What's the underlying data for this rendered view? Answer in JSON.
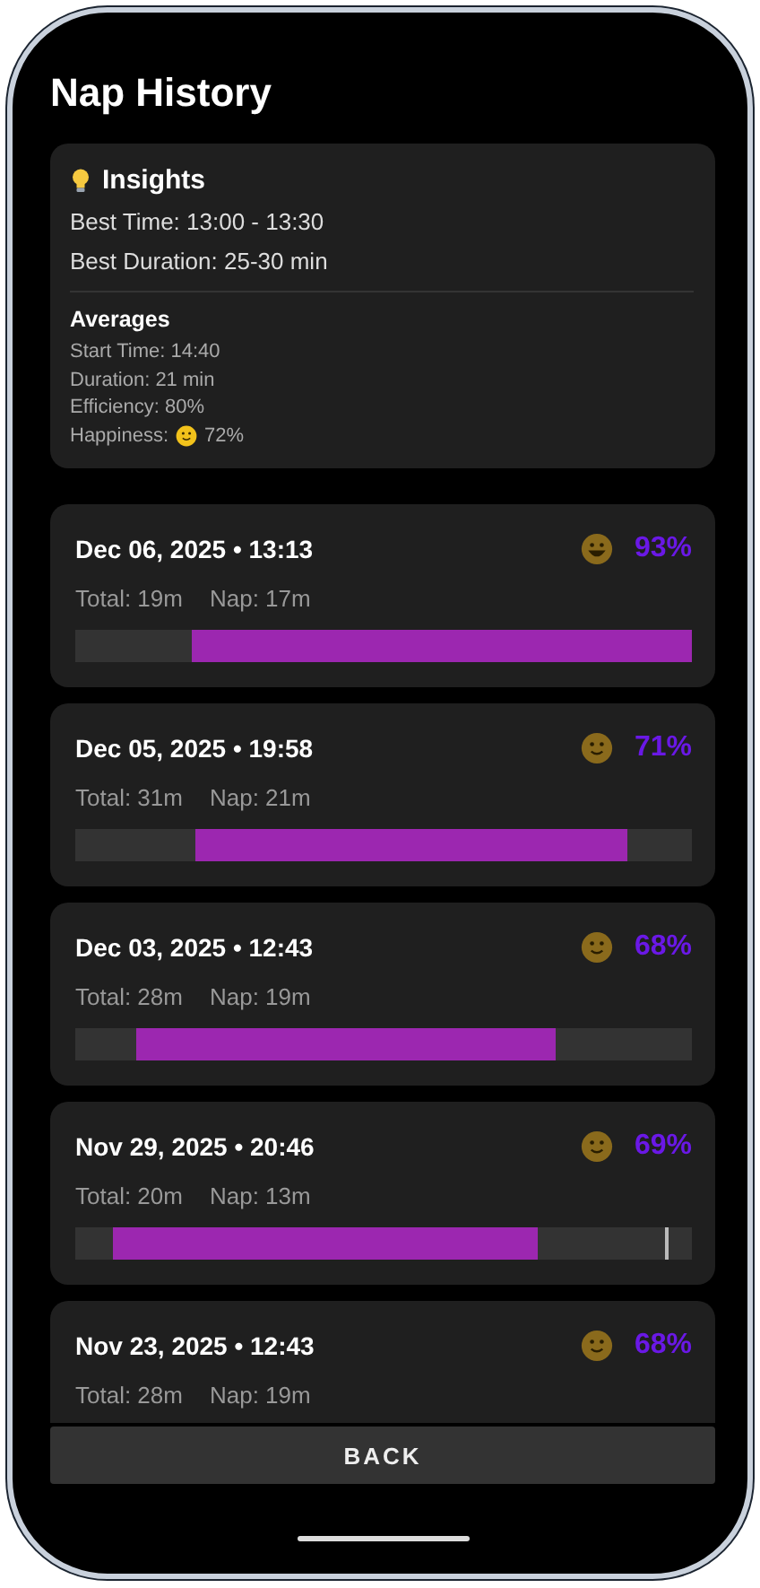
{
  "title": "Nap History",
  "insights": {
    "title": "Insights",
    "lines": [
      "Best Time: 13:00 - 13:30",
      "Best Duration: 25-30 min"
    ],
    "averages": {
      "title": "Averages",
      "lines": [
        {
          "kind": "text",
          "text": "Start Time: 14:40"
        },
        {
          "kind": "text",
          "text": "Duration: 21 min"
        },
        {
          "kind": "text",
          "text": "Efficiency: 80%"
        },
        {
          "kind": "smile",
          "label": "Happiness:",
          "text": "72%"
        }
      ]
    }
  },
  "naps": [
    {
      "kind": "grin",
      "date": "Dec 06, 2025 • 13:13",
      "score": "93%",
      "total": "Total: 19m",
      "nap": "Nap: 17m"
    },
    {
      "kind": "smile",
      "date": "Dec 05, 2025 • 19:58",
      "score": "71%",
      "total": "Total: 31m",
      "nap": "Nap: 21m"
    },
    {
      "kind": "smile",
      "date": "Dec 03, 2025 • 12:43",
      "score": "68%",
      "total": "Total: 28m",
      "nap": "Nap: 19m"
    },
    {
      "kind": "smile",
      "date": "Nov 29, 2025 • 20:46",
      "score": "69%",
      "total": "Total: 20m",
      "nap": "Nap: 13m"
    },
    {
      "kind": "smile",
      "date": "Nov 23, 2025 • 12:43",
      "score": "68%",
      "total": "Total: 28m",
      "nap": "Nap: 19m"
    }
  ],
  "back_button": "BACK"
}
